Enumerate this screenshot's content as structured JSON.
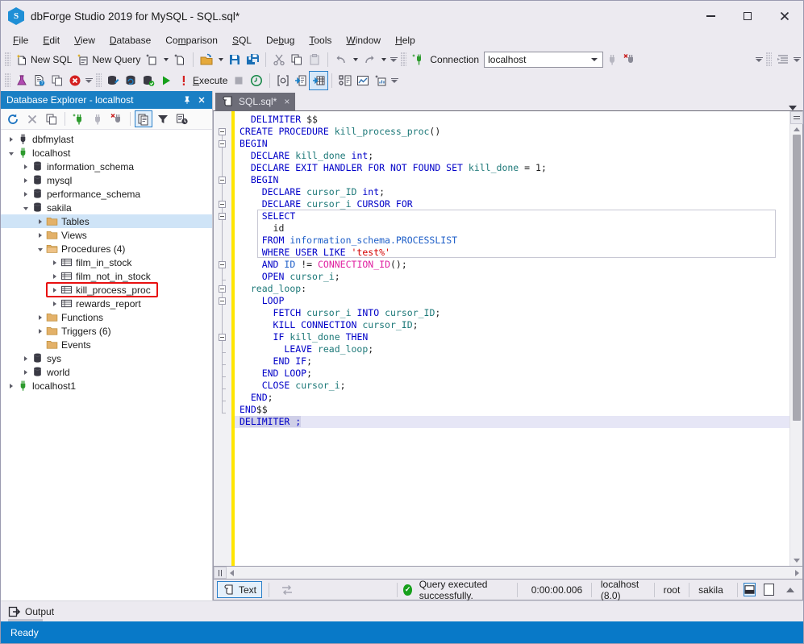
{
  "window": {
    "title": "dbForge Studio 2019 for MySQL - SQL.sql*",
    "logo_letter": "S",
    "minimize": "minimize-button",
    "maximize": "maximize-button",
    "close": "close-button"
  },
  "menubar": {
    "items": [
      {
        "label": "File",
        "mnemonic": "F"
      },
      {
        "label": "Edit",
        "mnemonic": "E"
      },
      {
        "label": "View",
        "mnemonic": "V"
      },
      {
        "label": "Database",
        "mnemonic": "D"
      },
      {
        "label": "Comparison",
        "mnemonic": "m"
      },
      {
        "label": "SQL",
        "mnemonic": "S"
      },
      {
        "label": "Debug",
        "mnemonic": "b"
      },
      {
        "label": "Tools",
        "mnemonic": "T"
      },
      {
        "label": "Window",
        "mnemonic": "W"
      },
      {
        "label": "Help",
        "mnemonic": "H"
      }
    ]
  },
  "toolbar_top": {
    "new_sql": "New SQL",
    "new_query": "New Query",
    "connection_label": "Connection",
    "connection_value": "localhost"
  },
  "toolbar_second": {
    "execute": "Execute"
  },
  "db_explorer": {
    "title": "Database Explorer - localhost",
    "pin": "pin-icon",
    "close": "close-icon",
    "tree": [
      {
        "label": "dbfmylast",
        "indent": 0,
        "icon": "connection",
        "state": "collapsed",
        "selected": false
      },
      {
        "label": "localhost",
        "indent": 0,
        "icon": "connection-active",
        "state": "expanded",
        "selected": false
      },
      {
        "label": "information_schema",
        "indent": 1,
        "icon": "database",
        "state": "collapsed",
        "selected": false
      },
      {
        "label": "mysql",
        "indent": 1,
        "icon": "database",
        "state": "collapsed",
        "selected": false
      },
      {
        "label": "performance_schema",
        "indent": 1,
        "icon": "database",
        "state": "collapsed",
        "selected": false
      },
      {
        "label": "sakila",
        "indent": 1,
        "icon": "database",
        "state": "expanded",
        "selected": false
      },
      {
        "label": "Tables",
        "indent": 2,
        "icon": "folder",
        "state": "collapsed",
        "selected": true
      },
      {
        "label": "Views",
        "indent": 2,
        "icon": "folder",
        "state": "collapsed",
        "selected": false
      },
      {
        "label": "Procedures (4)",
        "indent": 2,
        "icon": "folder-open",
        "state": "expanded",
        "selected": false
      },
      {
        "label": "film_in_stock",
        "indent": 3,
        "icon": "proc",
        "state": "collapsed",
        "selected": false
      },
      {
        "label": "film_not_in_stock",
        "indent": 3,
        "icon": "proc",
        "state": "collapsed",
        "selected": false
      },
      {
        "label": "kill_process_proc",
        "indent": 3,
        "icon": "proc",
        "state": "collapsed",
        "selected": false,
        "highlighted": true
      },
      {
        "label": "rewards_report",
        "indent": 3,
        "icon": "proc",
        "state": "collapsed",
        "selected": false
      },
      {
        "label": "Functions",
        "indent": 2,
        "icon": "folder",
        "state": "collapsed",
        "selected": false
      },
      {
        "label": "Triggers (6)",
        "indent": 2,
        "icon": "folder",
        "state": "collapsed",
        "selected": false
      },
      {
        "label": "Events",
        "indent": 2,
        "icon": "folder",
        "state": "none",
        "selected": false
      },
      {
        "label": "sys",
        "indent": 1,
        "icon": "database",
        "state": "collapsed",
        "selected": false
      },
      {
        "label": "world",
        "indent": 1,
        "icon": "database",
        "state": "collapsed",
        "selected": false
      },
      {
        "label": "localhost1",
        "indent": 0,
        "icon": "connection-active",
        "state": "collapsed",
        "selected": false
      }
    ]
  },
  "editor": {
    "tab_label": "SQL.sql*",
    "tab_close": "×",
    "lines": [
      [
        {
          "t": "  ",
          "c": "pl"
        },
        {
          "t": "DELIMITER",
          "c": "kw"
        },
        {
          "t": " $$",
          "c": "pl"
        }
      ],
      [
        {
          "t": "CREATE PROCEDURE",
          "c": "kw"
        },
        {
          "t": " ",
          "c": "pl"
        },
        {
          "t": "kill_process_proc",
          "c": "id"
        },
        {
          "t": "()",
          "c": "pl"
        }
      ],
      [
        {
          "t": "BEGIN",
          "c": "kw"
        }
      ],
      [
        {
          "t": "  ",
          "c": "pl"
        },
        {
          "t": "DECLARE",
          "c": "kw"
        },
        {
          "t": " ",
          "c": "pl"
        },
        {
          "t": "kill_done",
          "c": "id"
        },
        {
          "t": " ",
          "c": "pl"
        },
        {
          "t": "int",
          "c": "kw"
        },
        {
          "t": ";",
          "c": "pl"
        }
      ],
      [
        {
          "t": "  ",
          "c": "pl"
        },
        {
          "t": "DECLARE EXIT HANDLER FOR NOT FOUND SET",
          "c": "kw"
        },
        {
          "t": " ",
          "c": "pl"
        },
        {
          "t": "kill_done",
          "c": "id"
        },
        {
          "t": " = ",
          "c": "pl"
        },
        {
          "t": "1",
          "c": "num"
        },
        {
          "t": ";",
          "c": "pl"
        }
      ],
      [
        {
          "t": "  ",
          "c": "pl"
        },
        {
          "t": "BEGIN",
          "c": "kw"
        }
      ],
      [
        {
          "t": "    ",
          "c": "pl"
        },
        {
          "t": "DECLARE",
          "c": "kw"
        },
        {
          "t": " ",
          "c": "pl"
        },
        {
          "t": "cursor_ID",
          "c": "id"
        },
        {
          "t": " ",
          "c": "pl"
        },
        {
          "t": "int",
          "c": "kw"
        },
        {
          "t": ";",
          "c": "pl"
        }
      ],
      [
        {
          "t": "    ",
          "c": "pl"
        },
        {
          "t": "DECLARE",
          "c": "kw"
        },
        {
          "t": " ",
          "c": "pl"
        },
        {
          "t": "cursor_i",
          "c": "id"
        },
        {
          "t": " ",
          "c": "pl"
        },
        {
          "t": "CURSOR FOR",
          "c": "kw"
        }
      ],
      [
        {
          "t": "    ",
          "c": "pl"
        },
        {
          "t": "SELECT",
          "c": "kw"
        }
      ],
      [
        {
          "t": "      ",
          "c": "pl"
        },
        {
          "t": "id",
          "c": "pl"
        }
      ],
      [
        {
          "t": "    ",
          "c": "pl"
        },
        {
          "t": "FROM",
          "c": "kw"
        },
        {
          "t": " ",
          "c": "pl"
        },
        {
          "t": "information_schema.PROCESSLIST",
          "c": "kw2"
        }
      ],
      [
        {
          "t": "    ",
          "c": "pl"
        },
        {
          "t": "WHERE USER LIKE",
          "c": "kw"
        },
        {
          "t": " ",
          "c": "pl"
        },
        {
          "t": "'test%'",
          "c": "str"
        }
      ],
      [
        {
          "t": "    ",
          "c": "pl"
        },
        {
          "t": "AND",
          "c": "kw"
        },
        {
          "t": " ",
          "c": "pl"
        },
        {
          "t": "ID",
          "c": "kw2"
        },
        {
          "t": " != ",
          "c": "pl"
        },
        {
          "t": "CONNECTION_ID",
          "c": "fn"
        },
        {
          "t": "()",
          "c": "pl"
        },
        {
          "t": ";",
          "c": "pl"
        }
      ],
      [
        {
          "t": "    ",
          "c": "pl"
        },
        {
          "t": "OPEN",
          "c": "kw"
        },
        {
          "t": " ",
          "c": "pl"
        },
        {
          "t": "cursor_i",
          "c": "id"
        },
        {
          "t": ";",
          "c": "pl"
        }
      ],
      [
        {
          "t": "  ",
          "c": "pl"
        },
        {
          "t": "read_loop",
          "c": "id"
        },
        {
          "t": ":",
          "c": "pl"
        }
      ],
      [
        {
          "t": "    ",
          "c": "pl"
        },
        {
          "t": "LOOP",
          "c": "kw"
        }
      ],
      [
        {
          "t": "      ",
          "c": "pl"
        },
        {
          "t": "FETCH",
          "c": "kw"
        },
        {
          "t": " ",
          "c": "pl"
        },
        {
          "t": "cursor_i",
          "c": "id"
        },
        {
          "t": " ",
          "c": "pl"
        },
        {
          "t": "INTO",
          "c": "kw"
        },
        {
          "t": " ",
          "c": "pl"
        },
        {
          "t": "cursor_ID",
          "c": "id"
        },
        {
          "t": ";",
          "c": "pl"
        }
      ],
      [
        {
          "t": "      ",
          "c": "pl"
        },
        {
          "t": "KILL CONNECTION",
          "c": "kw"
        },
        {
          "t": " ",
          "c": "pl"
        },
        {
          "t": "cursor_ID",
          "c": "id"
        },
        {
          "t": ";",
          "c": "pl"
        }
      ],
      [
        {
          "t": "      ",
          "c": "pl"
        },
        {
          "t": "IF",
          "c": "kw"
        },
        {
          "t": " ",
          "c": "pl"
        },
        {
          "t": "kill_done",
          "c": "id"
        },
        {
          "t": " ",
          "c": "pl"
        },
        {
          "t": "THEN",
          "c": "kw"
        }
      ],
      [
        {
          "t": "        ",
          "c": "pl"
        },
        {
          "t": "LEAVE",
          "c": "kw"
        },
        {
          "t": " ",
          "c": "pl"
        },
        {
          "t": "read_loop",
          "c": "id"
        },
        {
          "t": ";",
          "c": "pl"
        }
      ],
      [
        {
          "t": "      ",
          "c": "pl"
        },
        {
          "t": "END IF",
          "c": "kw"
        },
        {
          "t": ";",
          "c": "pl"
        }
      ],
      [
        {
          "t": "    ",
          "c": "pl"
        },
        {
          "t": "END LOOP",
          "c": "kw"
        },
        {
          "t": ";",
          "c": "pl"
        }
      ],
      [
        {
          "t": "    ",
          "c": "pl"
        },
        {
          "t": "CLOSE",
          "c": "kw"
        },
        {
          "t": " ",
          "c": "pl"
        },
        {
          "t": "cursor_i",
          "c": "id"
        },
        {
          "t": ";",
          "c": "pl"
        }
      ],
      [
        {
          "t": "  ",
          "c": "pl"
        },
        {
          "t": "END",
          "c": "kw"
        },
        {
          "t": ";",
          "c": "pl"
        }
      ],
      [
        {
          "t": "END",
          "c": "kw"
        },
        {
          "t": "$$",
          "c": "pl"
        }
      ],
      [
        {
          "t": "DELIMITER ;",
          "c": "kw sel-text"
        }
      ]
    ]
  },
  "editor_status": {
    "text_button": "Text",
    "message": "Query executed successfully.",
    "duration": "0:00:00.006",
    "server": "localhost (8.0)",
    "user": "root",
    "database": "sakila"
  },
  "output_panel": {
    "label": "Output"
  },
  "statusbar": {
    "text": "Ready"
  },
  "colors": {
    "accent_blue": "#0879c8",
    "panel_header_blue": "#1a7fc4",
    "selection_blue": "#cfe4f7",
    "highlight_red": "#e81010",
    "change_bar_yellow": "#ffe500",
    "success_green": "#17a01c",
    "tab_gray": "#6d6d78"
  }
}
